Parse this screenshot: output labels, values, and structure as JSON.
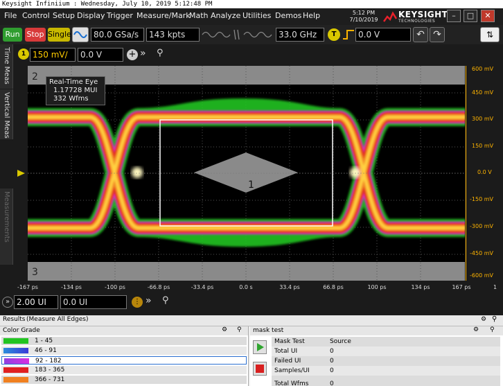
{
  "window": {
    "title": "Keysight Infiniium : Wednesday, July 10, 2019 5:12:48 PM"
  },
  "menu": [
    "File",
    "Control",
    "Setup",
    "Display",
    "Trigger",
    "Measure/Mark",
    "Math",
    "Analyze",
    "Utilities",
    "Demos",
    "Help"
  ],
  "clock": {
    "time": "5:12 PM",
    "date": "7/10/2019"
  },
  "brand": {
    "name": "KEYSIGHT",
    "sub": "TECHNOLOGIES"
  },
  "toolbar": {
    "run": "Run",
    "stop": "Stop",
    "single": "Single",
    "sample_rate": "80.0 GSa/s",
    "memory": "143 kpts",
    "bandwidth": "33.0 GHz",
    "trigger_badge": "T",
    "trigger_level": "0.0 V"
  },
  "channel": {
    "badge": "1",
    "scale": "150 mV/",
    "offset": "0.0 V"
  },
  "side_tabs": [
    "Time Meas",
    "Vertical Meas",
    "Measurements"
  ],
  "plot": {
    "marker_top": "2",
    "marker_bottom": "3",
    "marker_center": "1",
    "info": {
      "title": "Real-Time Eye",
      "mui": "1.17728 MUI",
      "wfms": "332 Wfms"
    }
  },
  "y_ruler": [
    "600 mV",
    "450 mV",
    "300 mV",
    "150 mV",
    "0.0 V",
    "-150 mV",
    "-300 mV",
    "-450 mV",
    "-600 mV"
  ],
  "x_ticks": [
    "-167 ps",
    "-134 ps",
    "-100 ps",
    "-66.8 ps",
    "-33.4 ps",
    "0.0 s",
    "33.4 ps",
    "66.8 ps",
    "100 ps",
    "134 ps",
    "167 ps"
  ],
  "x_end": "1",
  "timebase": {
    "scale": "2.00 UI",
    "position": "0.0 UI"
  },
  "results": {
    "header": "Results",
    "header_sub": "(Measure All Edges)",
    "color_grade_title": "Color Grade",
    "legend": [
      {
        "range": "1 - 45",
        "color": "#22c422"
      },
      {
        "range": "46 - 91",
        "color": "#3a3ad8"
      },
      {
        "range": "92 - 182",
        "color": "#d830e0"
      },
      {
        "range": "183 - 365",
        "color": "#e02020"
      },
      {
        "range": "366 - 731",
        "color": "#f08020"
      }
    ],
    "mask_test": {
      "title": "mask test",
      "col_test": "Mask Test",
      "col_source": "Source",
      "rows": [
        {
          "label": "Total UI",
          "value": "0"
        },
        {
          "label": "Failed UI",
          "value": "0"
        },
        {
          "label": "Samples/UI",
          "value": "0"
        },
        {
          "label": "Total Wfms",
          "value": "0"
        }
      ]
    }
  }
}
